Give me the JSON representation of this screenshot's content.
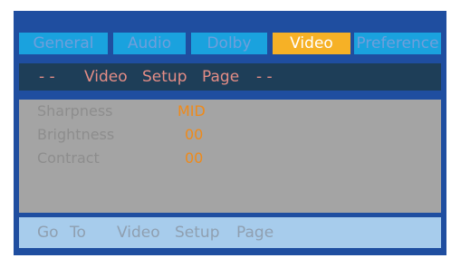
{
  "tabs": [
    {
      "label": "General",
      "active": false
    },
    {
      "label": "Audio",
      "active": false
    },
    {
      "label": "Dolby",
      "active": false
    },
    {
      "label": "Video",
      "active": true
    },
    {
      "label": "Preference",
      "active": false
    }
  ],
  "header": {
    "dash_left": "- -",
    "word1": "Video",
    "word2": "Setup",
    "word3": "Page",
    "dash_right": "- -"
  },
  "settings": [
    {
      "label": "Sharpness",
      "value": "MID"
    },
    {
      "label": "Brightness",
      "value": "00"
    },
    {
      "label": "Contract",
      "value": "00"
    }
  ],
  "footer": {
    "word1": "Go",
    "word2": "To",
    "word3": "Video",
    "word4": "Setup",
    "word5": "Page"
  },
  "colors": {
    "frame": "#1f4ea0",
    "tab": "#1aa2de",
    "tab_active": "#f6b126",
    "header_bg": "#1e3e58",
    "header_text": "#e48d86",
    "panel": "#a4a4a4",
    "value_text": "#ef8a1a",
    "footer_bg": "#a7ccec"
  }
}
